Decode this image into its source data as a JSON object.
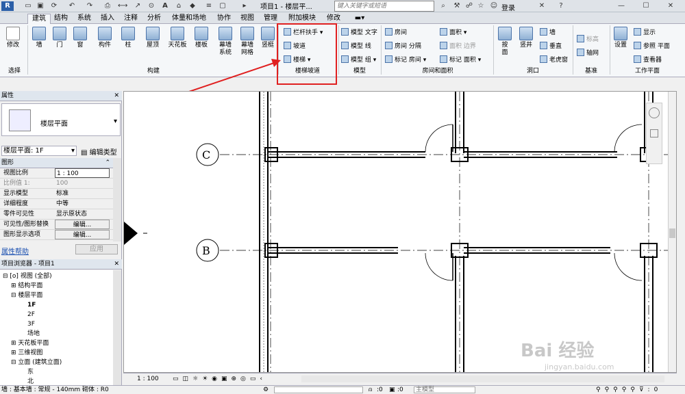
{
  "app": {
    "title": "项目1 - 楼层平...",
    "search_placeholder": "键入关键字或短语",
    "login": "登录",
    "menu_glyph": "▸"
  },
  "tabs": [
    "建筑",
    "结构",
    "系统",
    "插入",
    "注释",
    "分析",
    "体量和场地",
    "协作",
    "视图",
    "管理",
    "附加模块",
    "修改"
  ],
  "ribbon": {
    "select": {
      "modify": "修改",
      "group": "选择"
    },
    "build": {
      "items": [
        "墙",
        "门",
        "窗",
        "构件",
        "柱",
        "屋顶",
        "天花板",
        "楼板",
        "幕墙\n系统",
        "幕墙\n网格",
        "竖梃"
      ],
      "group": "构建"
    },
    "circulation": {
      "items": [
        "栏杆扶手",
        "坡道",
        "楼梯"
      ],
      "group": "楼梯坡道"
    },
    "model": {
      "items": [
        "模型 文字",
        "模型 线",
        "模型 组"
      ],
      "group": "模型"
    },
    "room": {
      "items": [
        "房间",
        "房间 分隔",
        "标记 房间",
        "面积",
        "面积 边界",
        "标记 面积"
      ],
      "group": "房间和面积"
    },
    "opening": {
      "items": [
        "按\n面",
        "竖井",
        "墙",
        "垂直",
        "老虎窗"
      ],
      "group": "洞口"
    },
    "datum": {
      "items": [
        "标高",
        "轴网"
      ],
      "group": "基准"
    },
    "workplane": {
      "items": [
        "设置",
        "显示",
        "参照 平面",
        "查看器"
      ],
      "group": "工作平面"
    }
  },
  "properties": {
    "header": "属性",
    "close_glyph": "✕",
    "type_name": "楼层平面",
    "instance_selector": "楼层平面: 1F",
    "edit_type": "编辑类型",
    "section": "图形",
    "rows": [
      {
        "k": "视图比例",
        "v": "1 : 100"
      },
      {
        "k": "比例值 1:",
        "v": "100"
      },
      {
        "k": "显示模型",
        "v": "标准"
      },
      {
        "k": "详细程度",
        "v": "中等"
      },
      {
        "k": "零件可见性",
        "v": "显示原状态"
      },
      {
        "k": "可见性/图形替换",
        "v": "编辑..."
      },
      {
        "k": "图形显示选项",
        "v": "编辑..."
      }
    ],
    "help": "属性帮助",
    "apply": "应用"
  },
  "browser": {
    "header": "项目浏览器 - 项目1",
    "items": [
      "视图 (全部)",
      "结构平面",
      "楼层平面",
      "1F",
      "2F",
      "3F",
      "场地",
      "天花板平面",
      "三维视图",
      "立面 (建筑立面)",
      "东",
      "北"
    ]
  },
  "canvas": {
    "grid_c": "C",
    "grid_b": "B"
  },
  "view_status": {
    "scale": "1 : 100"
  },
  "status": {
    "text": "墙 : 基本墙 : 常规 - 140mm 砌体 : R0",
    "zero1": ":0",
    "zero2": ":0",
    "model": "主模型"
  },
  "watermark": {
    "brand": "Bai 经验",
    "url": "jingyan.baidu.com"
  },
  "colors": {
    "highlight": "#e02020",
    "ribbon_bg": "#f5f7f9",
    "wall": "#000000"
  }
}
